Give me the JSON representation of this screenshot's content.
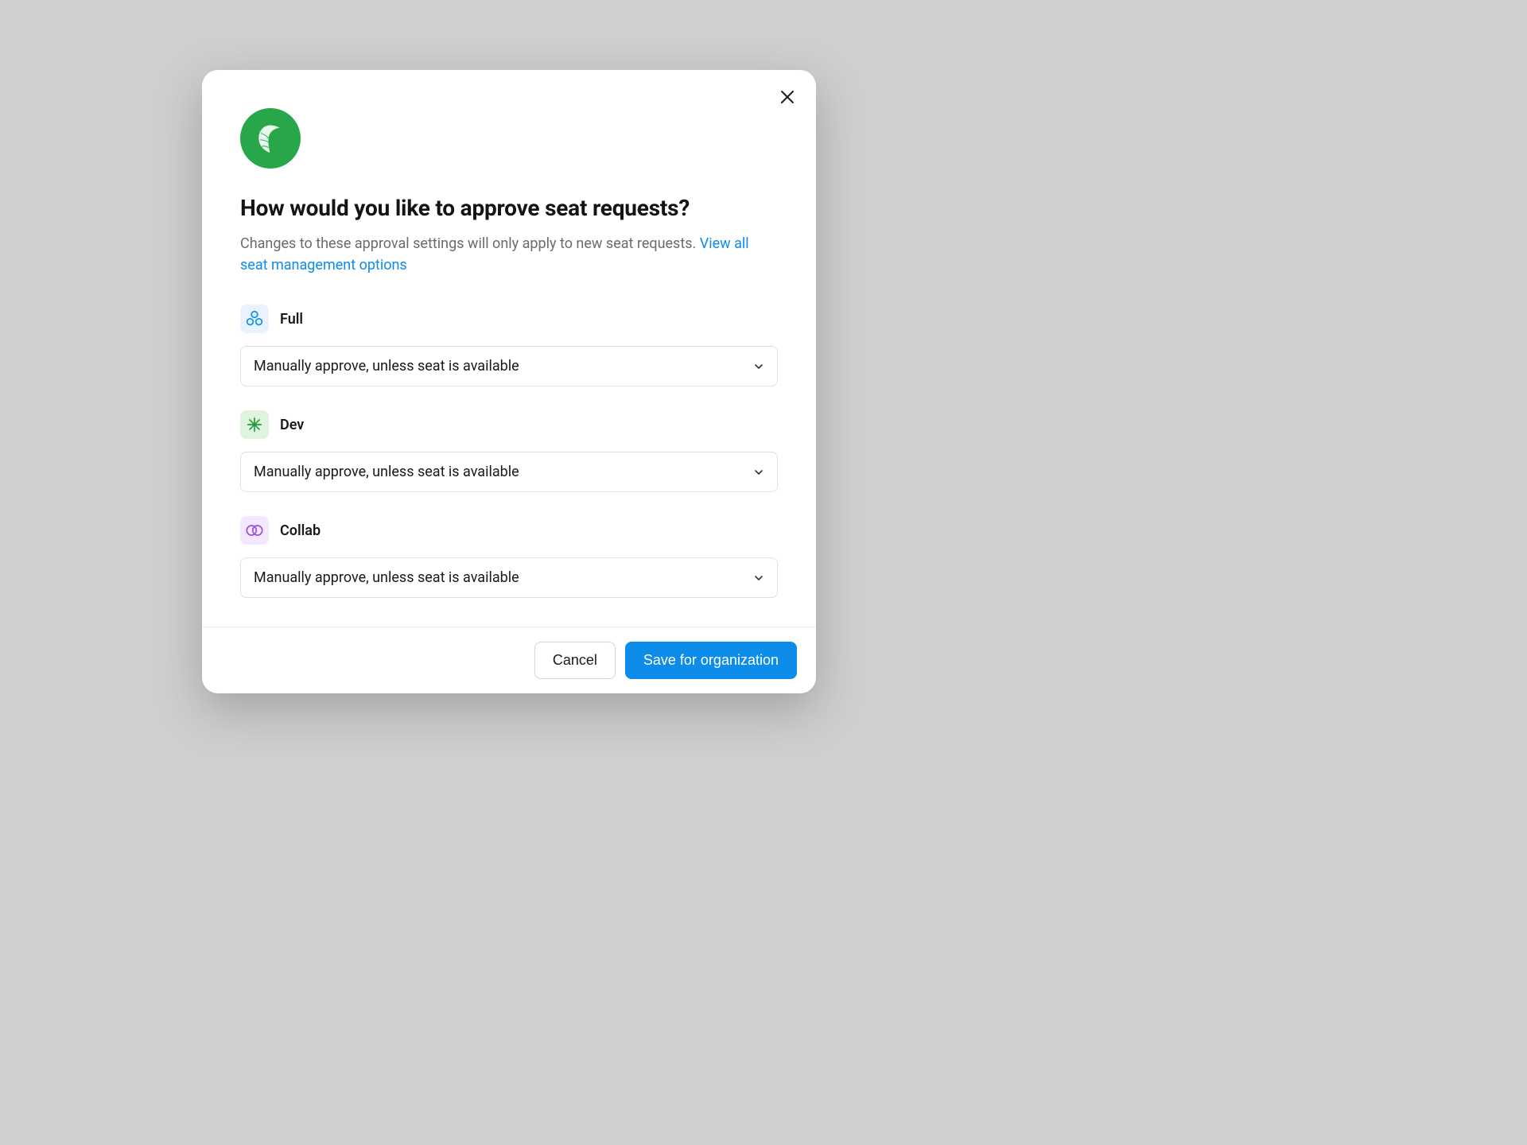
{
  "modal": {
    "title": "How would you like to approve seat requests?",
    "description_text": "Changes to these approval settings will only apply to new seat requests. ",
    "description_link": "View all seat management options"
  },
  "seats": [
    {
      "key": "full",
      "label": "Full",
      "selected": "Manually approve, unless seat is available"
    },
    {
      "key": "dev",
      "label": "Dev",
      "selected": "Manually approve, unless seat is available"
    },
    {
      "key": "collab",
      "label": "Collab",
      "selected": "Manually approve, unless seat is available"
    }
  ],
  "footer": {
    "cancel_label": "Cancel",
    "save_label": "Save for organization"
  }
}
